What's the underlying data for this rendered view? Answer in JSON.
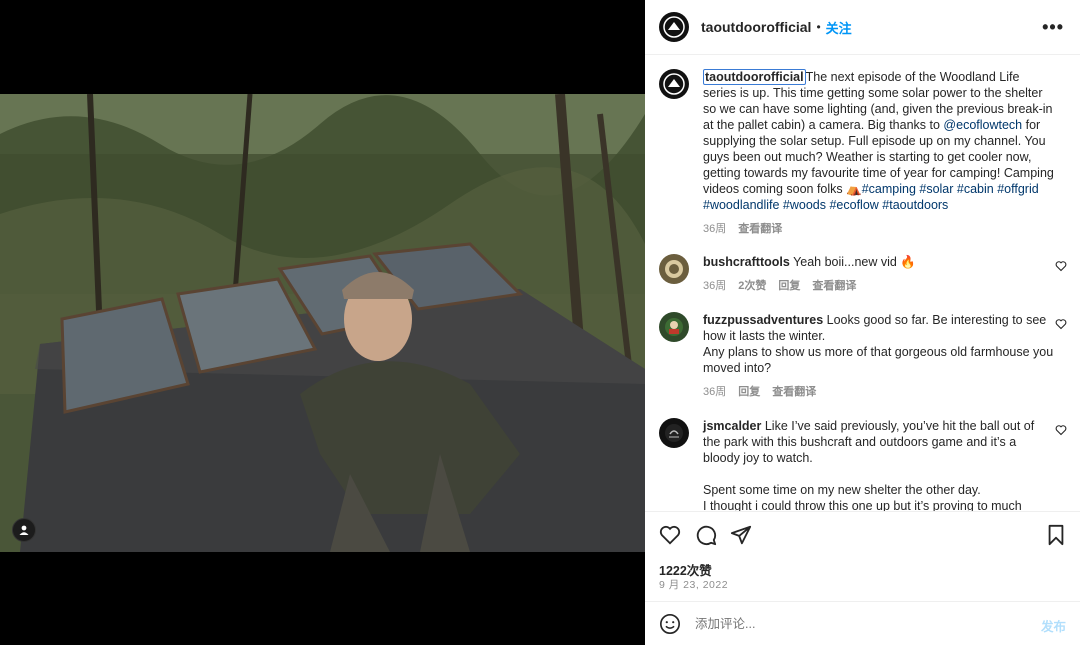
{
  "post": {
    "author": "taoutdoorofficial",
    "follow_label": "关注",
    "caption": {
      "pre": "The next episode of the Woodland Life series is up. This time getting some solar power to the shelter so we can have some lighting (and, given the previous break-in at the pallet cabin) a camera. Big thanks to ",
      "mention": "@ecoflowtech",
      "mid": " for supplying the solar setup. Full episode up on my channel. You guys been out much? Weather is starting to get cooler now, getting towards my favourite time of year for camping! Camping videos coming soon folks ⛺",
      "tags": "#camping #solar #cabin #offgrid #woodlandlife #woods #ecoflow #taoutdoors"
    },
    "caption_time": "36周",
    "caption_translate": "查看翻译",
    "likes": "1222次赞",
    "date": "9 月 23, 2022",
    "comment_placeholder": "添加评论...",
    "post_button": "发布"
  },
  "comments": [
    {
      "user": "bushcrafttools",
      "text": "Yeah boii...new vid 🔥",
      "time": "36周",
      "likes": "2次赞",
      "reply": "回复",
      "translate": "查看翻译"
    },
    {
      "user": "fuzzpussadventures",
      "text": "Looks good so far. Be interesting to see how it lasts the winter.",
      "text2": "Any plans to show us more of that gorgeous old farmhouse you moved into?",
      "time": "36周",
      "reply": "回复",
      "translate": "查看翻译"
    },
    {
      "user": "jsmcalder",
      "text": "Like I’ve said previously, you’ve hit the ball out of the park with this bushcraft and outdoors game and it’s a bloody joy to watch.",
      "text2": "Spent some time on my new shelter the other day.",
      "text3": "I thought i could throw this one up but it’s proving to much"
    }
  ],
  "colors": {
    "link": "#00376b",
    "follow": "#0095f6",
    "post_disabled": "#b2dffc"
  }
}
